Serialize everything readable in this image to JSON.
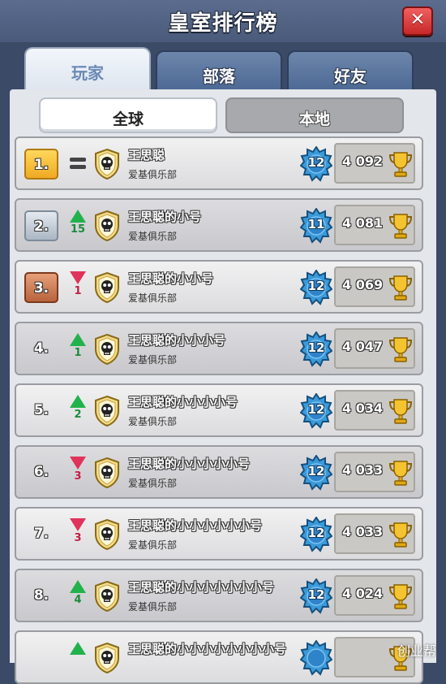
{
  "window": {
    "title": "皇室排行榜",
    "close_label": "✕"
  },
  "tabs": [
    {
      "label": "玩家",
      "active": true
    },
    {
      "label": "部落",
      "active": false
    },
    {
      "label": "好友",
      "active": false
    }
  ],
  "subtabs": [
    {
      "label": "全球",
      "active": true
    },
    {
      "label": "本地",
      "active": false
    }
  ],
  "players": [
    {
      "rank": "1.",
      "medal": "gold",
      "trend": "same",
      "delta": "",
      "name": "王思聪",
      "club": "爱基俱乐部",
      "level": "12",
      "trophies": "4 092"
    },
    {
      "rank": "2.",
      "medal": "silver",
      "trend": "up",
      "delta": "15",
      "name": "王思聪的小号",
      "club": "爱基俱乐部",
      "level": "11",
      "trophies": "4 081"
    },
    {
      "rank": "3.",
      "medal": "bronze",
      "trend": "down",
      "delta": "1",
      "name": "王思聪的小小号",
      "club": "爱基俱乐部",
      "level": "12",
      "trophies": "4 069"
    },
    {
      "rank": "4.",
      "medal": "plain",
      "trend": "up",
      "delta": "1",
      "name": "王思聪的小小小号",
      "club": "爱基俱乐部",
      "level": "12",
      "trophies": "4 047"
    },
    {
      "rank": "5.",
      "medal": "plain",
      "trend": "up",
      "delta": "2",
      "name": "王思聪的小小小小号",
      "club": "爱基俱乐部",
      "level": "12",
      "trophies": "4 034"
    },
    {
      "rank": "6.",
      "medal": "plain",
      "trend": "down",
      "delta": "3",
      "name": "王思聪的小小小小小号",
      "club": "爱基俱乐部",
      "level": "12",
      "trophies": "4 033"
    },
    {
      "rank": "7.",
      "medal": "plain",
      "trend": "down",
      "delta": "3",
      "name": "王思聪的小小小小小小号",
      "club": "爱基俱乐部",
      "level": "12",
      "trophies": "4 033"
    },
    {
      "rank": "8.",
      "medal": "plain",
      "trend": "up",
      "delta": "4",
      "name": "王思聪的小小小小小小小号",
      "club": "爱基俱乐部",
      "level": "12",
      "trophies": "4 024"
    },
    {
      "rank": "",
      "medal": "plain",
      "trend": "up",
      "delta": "",
      "name": "王思聪的小小小小小小小小号",
      "club": "",
      "level": "",
      "trophies": ""
    }
  ],
  "watermark": "创业帮",
  "colors": {
    "accent_blue": "#2f83c9",
    "gold": "#f0a923",
    "trophy": "#e8b51e",
    "up": "#22b24c",
    "down": "#e0335b"
  },
  "icons": {
    "clan_badge": "skull-shield-icon",
    "level_badge": "level-star-icon",
    "trophy": "trophy-icon",
    "close": "close-icon"
  }
}
